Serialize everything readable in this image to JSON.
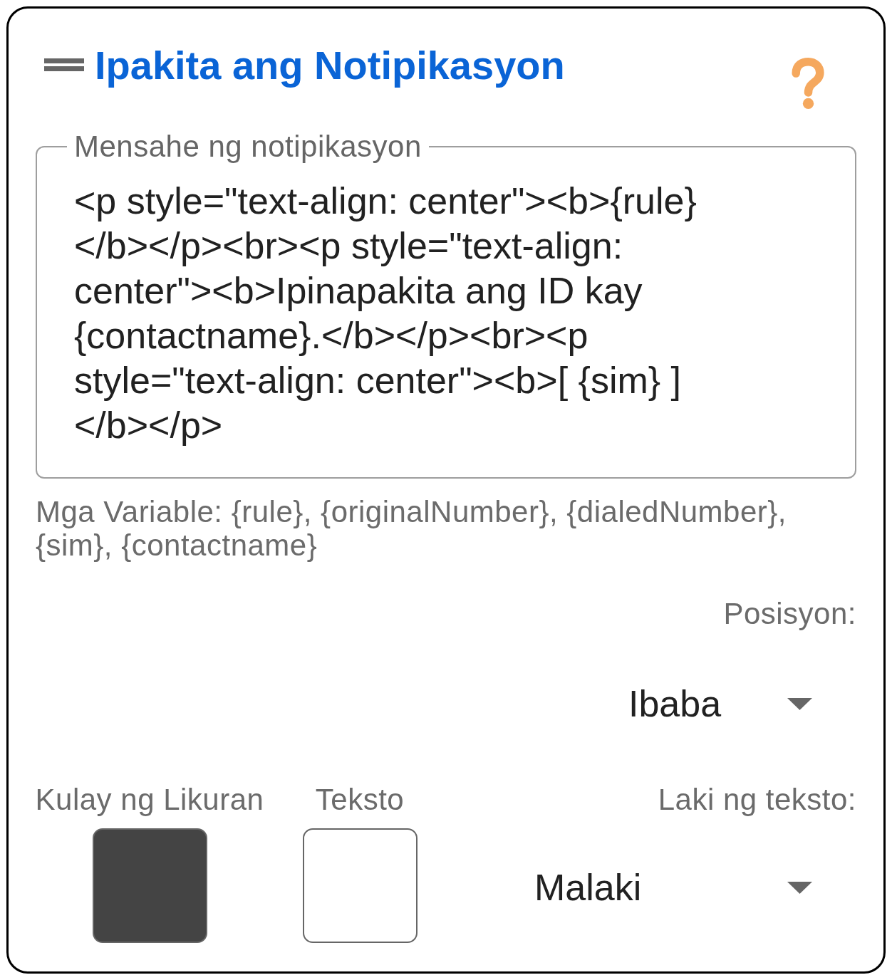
{
  "header": {
    "title": "Ipakita ang Notipikasyon"
  },
  "message_field": {
    "label": "Mensahe ng notipikasyon",
    "value": "<p style=\"text-align: center\"><b>{rule}</b></p><br><p style=\"text-align: center\"><b>Ipinapakita ang ID kay {contactname}.</b></p><br><p style=\"text-align: center\"><b>[ {sim} ]</b></p>"
  },
  "variables_hint": "Mga Variable: {rule}, {originalNumber}, {dialedNumber}, {sim}, {contactname}",
  "position": {
    "label": "Posisyon:",
    "value": "Ibaba"
  },
  "colors": [
    {
      "label": "Kulay ng Likuran",
      "color": "#444444"
    },
    {
      "label": "Teksto",
      "color": "#ffffff"
    }
  ],
  "text_size": {
    "label": "Laki ng teksto:",
    "value": "Malaki"
  }
}
